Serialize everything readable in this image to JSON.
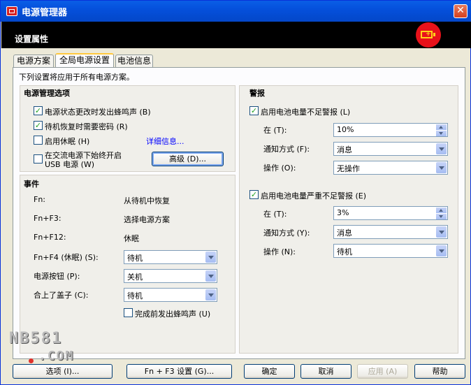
{
  "window": {
    "title": "电源管理器",
    "close_label": "✕"
  },
  "banner": {
    "title": "设置属性"
  },
  "tabs": [
    {
      "label": "电源方案"
    },
    {
      "label": "全局电源设置"
    },
    {
      "label": "电池信息"
    }
  ],
  "panel": {
    "description": "下列设置将应用于所有电源方案。"
  },
  "power_options": {
    "title": "电源管理选项",
    "beep_on_change": {
      "label": "电源状态更改时发出蜂鸣声 (B)",
      "checked": true
    },
    "password_on_resume": {
      "label": "待机恢复时需要密码 (R)",
      "checked": true
    },
    "enable_hibernate": {
      "label": "启用休眠 (H)",
      "checked": false
    },
    "details_link": "详细信息...",
    "usb_power": {
      "label_line1": "在交流电源下始终开启",
      "label_line2": "USB 电源 (W)",
      "checked": false
    },
    "advanced_button": "高级 (D)..."
  },
  "events": {
    "title": "事件",
    "fn": {
      "label": "Fn:",
      "value": "从待机中恢复"
    },
    "fn_f3": {
      "label": "Fn+F3:",
      "value": "选择电源方案"
    },
    "fn_f12": {
      "label": "Fn+F12:",
      "value": "休眠"
    },
    "fn_f4": {
      "label": "Fn+F4 (休眠) (S):",
      "value": "待机"
    },
    "power_button": {
      "label": "电源按钮 (P):",
      "value": "关机"
    },
    "lid_close": {
      "label": "合上了盖子 (C):",
      "value": "待机"
    },
    "beep_before": {
      "label": "完成前发出蜂鸣声 (U)",
      "checked": false
    }
  },
  "alarms": {
    "title": "警报",
    "low": {
      "label": "启用电池电量不足警报 (L)",
      "checked": true,
      "at_label": "在 (T):",
      "at_value": "10%",
      "notify_label": "通知方式 (F):",
      "notify_value": "消息",
      "action_label": "操作 (O):",
      "action_value": "无操作"
    },
    "critical": {
      "label": "启用电池电量严重不足警报 (E)",
      "checked": true,
      "at_label": "在 (T):",
      "at_value": "3%",
      "notify_label": "通知方式 (Y):",
      "notify_value": "消息",
      "action_label": "操作 (N):",
      "action_value": "待机"
    }
  },
  "footer": {
    "options_button": "选项 (I)...",
    "fn_f3_button": "Fn + F3 设置 (G)...",
    "ok_button": "确定",
    "cancel_button": "取消",
    "apply_button": "应用 (A)",
    "help_button": "帮助"
  },
  "watermark": {
    "line1": "NB581",
    "line2": ".COM"
  }
}
